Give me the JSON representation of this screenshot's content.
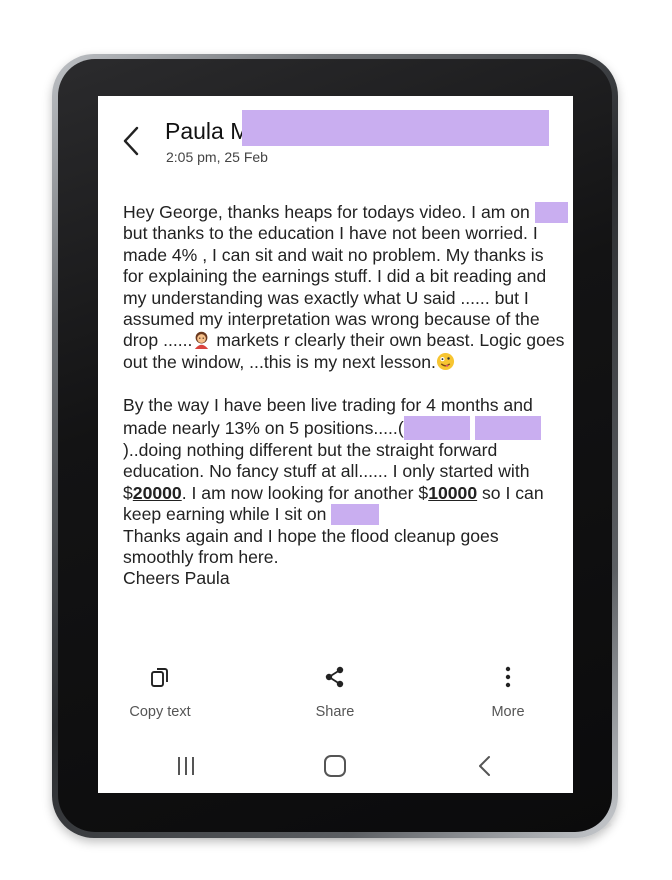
{
  "conversation": {
    "contact_name": "Paula M",
    "timestamp": "2:05 pm, 25 Feb"
  },
  "message": {
    "p1": [
      "Hey George, thanks heaps for todays video. I am on",
      "but thanks to the education I have not been worried. I made 4% , I can sit and wait no problem. My thanks is for explaining the earnings stuff. I did a bit reading and my understanding was exactly what U said ...... but I assumed my interpretation was wrong because of the drop ......",
      "markets r clearly their own beast. Logic goes out the window, ...this is my next lesson."
    ],
    "p2": [
      "By the way I have been live trading for 4 months and made nearly 13% on 5 positions.....(",
      ")..doing nothing different but the straight forward education. No fancy stuff at all...... I only started with $",
      "20000",
      ". I am now looking for another $",
      "10000",
      " so I can keep earning while I sit on",
      "Thanks again and I hope the flood cleanup goes smoothly from here.",
      "Cheers Paula"
    ]
  },
  "actions": [
    {
      "label": "Copy text",
      "icon": "copy-icon"
    },
    {
      "label": "Share",
      "icon": "share-icon"
    },
    {
      "label": "More",
      "icon": "more-vertical-icon"
    }
  ],
  "navbar": [
    {
      "icon": "recent-apps-icon"
    },
    {
      "icon": "home-icon"
    },
    {
      "icon": "back-icon"
    }
  ],
  "colors": {
    "redaction": "#c9aef0",
    "text": "#222222",
    "screen_bg": "#ffffff"
  }
}
